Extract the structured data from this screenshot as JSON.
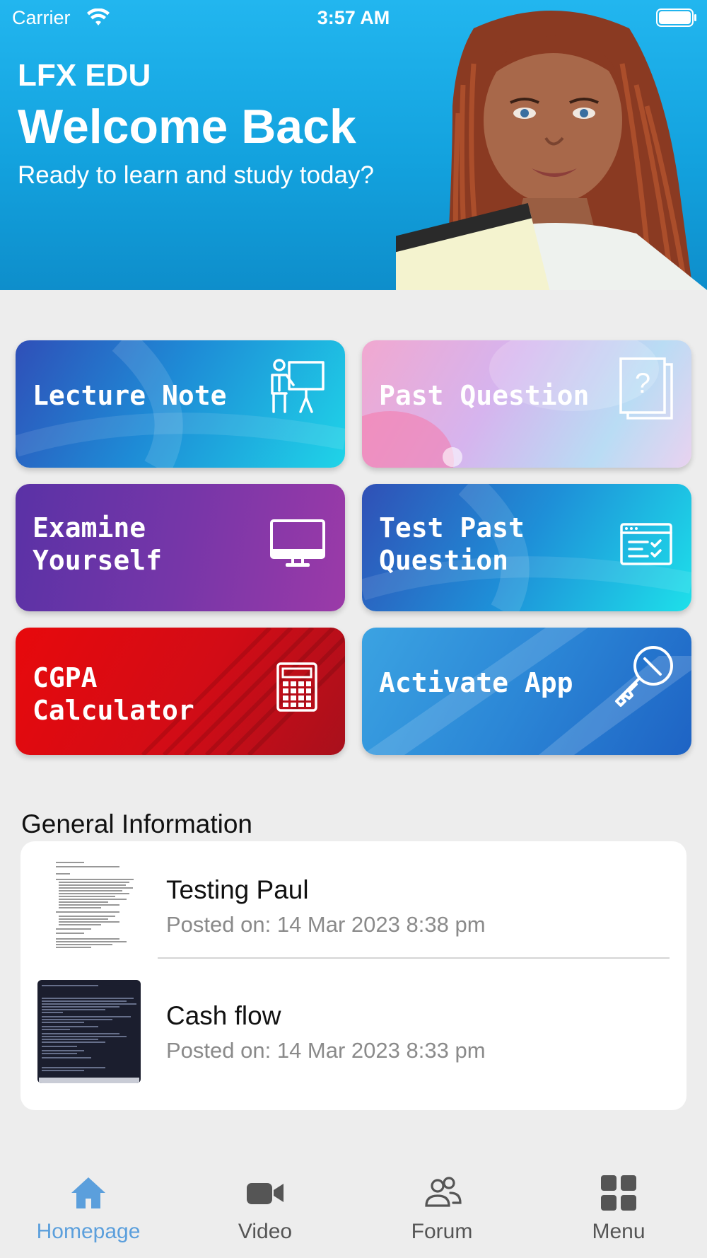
{
  "status_bar": {
    "carrier": "Carrier",
    "time": "3:57 AM"
  },
  "header": {
    "brand": "LFX EDU",
    "title": "Welcome Back",
    "subtitle": "Ready to learn and study today?"
  },
  "tiles": [
    {
      "label": "Lecture Note",
      "icon": "presentation-icon"
    },
    {
      "label": "Past Question",
      "icon": "question-document-icon"
    },
    {
      "label": "Examine\nYourself",
      "icon": "monitor-icon"
    },
    {
      "label": "Test Past\nQuestion",
      "icon": "checklist-window-icon"
    },
    {
      "label": "CGPA\nCalculator",
      "icon": "calculator-icon"
    },
    {
      "label": "Activate App",
      "icon": "key-icon"
    }
  ],
  "general_info": {
    "title": "General Information",
    "items": [
      {
        "title": "Testing Paul",
        "date": "Posted on: 14 Mar 2023 8:38 pm"
      },
      {
        "title": "Cash flow",
        "date": "Posted on: 14 Mar 2023 8:33 pm"
      }
    ]
  },
  "tabbar": {
    "items": [
      {
        "label": "Homepage",
        "icon": "home-icon",
        "active": true
      },
      {
        "label": "Video",
        "icon": "video-camera-icon"
      },
      {
        "label": "Forum",
        "icon": "people-icon"
      },
      {
        "label": "Menu",
        "icon": "grid-icon"
      }
    ]
  },
  "colors": {
    "header_blue": "#15a6e2",
    "tab_active": "#5b9fdc",
    "background": "#ededed"
  }
}
